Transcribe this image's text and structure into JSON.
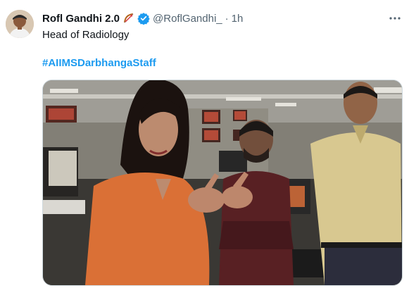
{
  "tweet": {
    "display_name": "Rofl Gandhi 2.0",
    "handle": "@RoflGandhi_",
    "separator": "·",
    "time": "1h",
    "text": "Head of Radiology",
    "hashtag": "#AIIMSDarbhangaStaff"
  },
  "icons": {
    "emoji": "bow-and-arrow-icon",
    "verified": "verified-badge-icon",
    "more": "more-options-icon"
  },
  "colors": {
    "link": "#1d9bf0",
    "verified": "#1d9bf0",
    "secondary_text": "#536471"
  }
}
